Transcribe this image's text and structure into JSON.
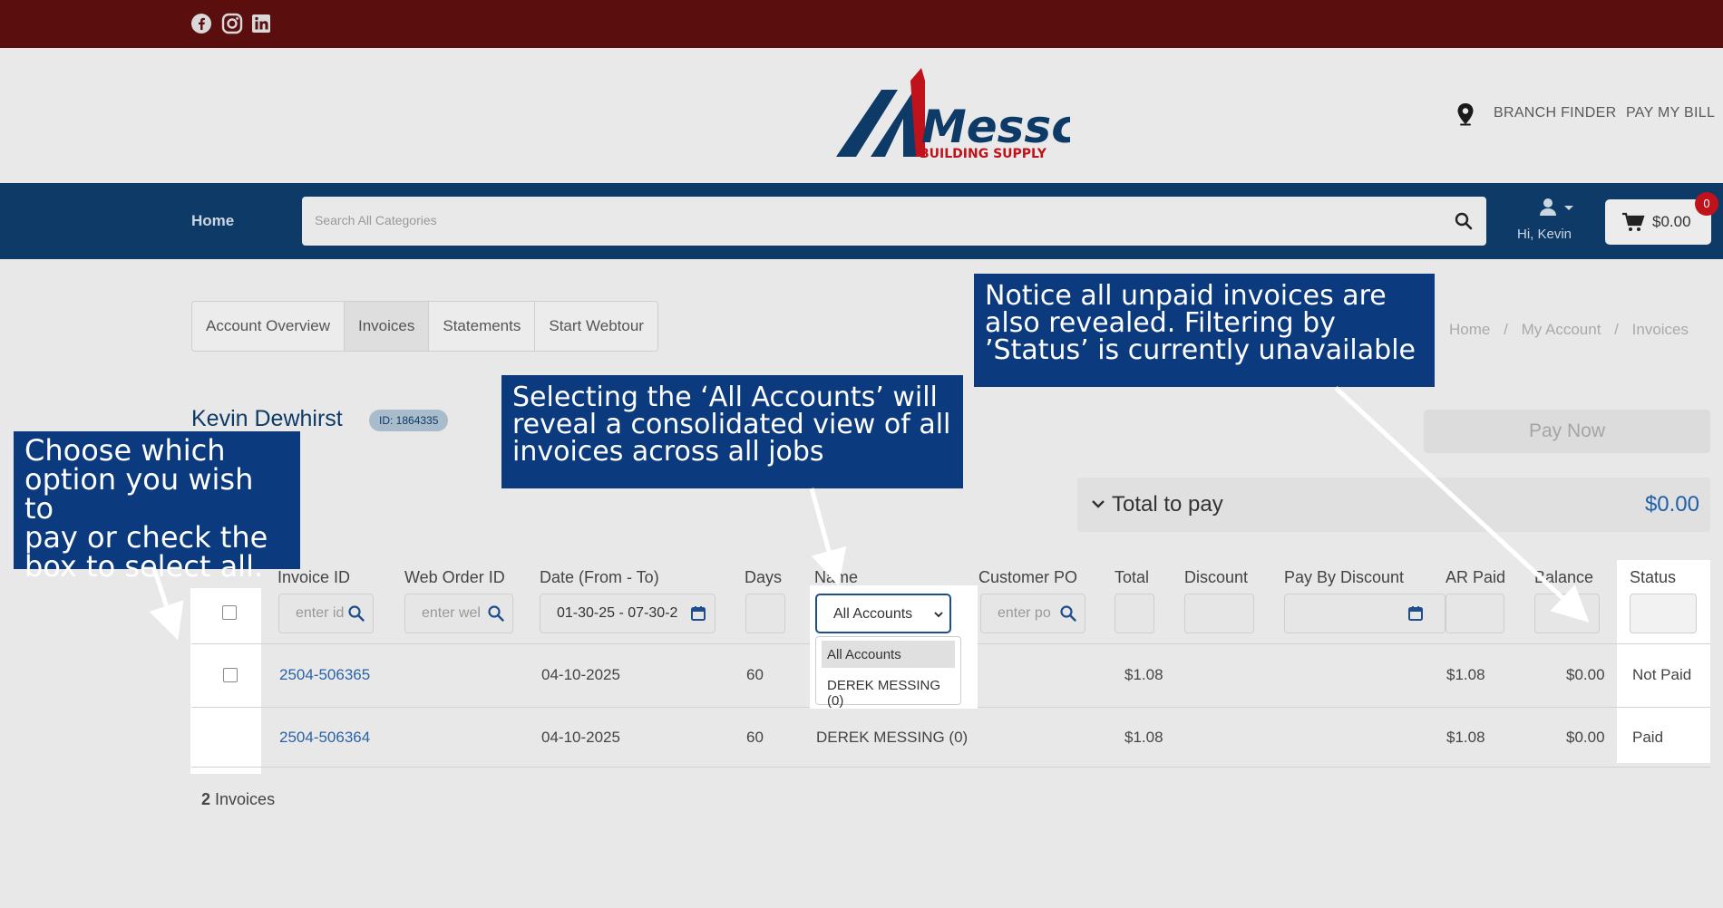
{
  "colors": {
    "top_bar": "#5a0e0e",
    "nav": "#0d3a66",
    "callout": "#0b3a7e",
    "link": "#2a63a6",
    "logo_red": "#c0121a",
    "logo_blue": "#0d3a66"
  },
  "social": [
    "facebook-icon",
    "instagram-icon",
    "linkedin-icon"
  ],
  "logo": {
    "name": "Messco",
    "tagline": "BUILDING SUPPLY"
  },
  "header": {
    "branch_finder": "BRANCH FINDER",
    "pay_bill": "PAY MY BILL"
  },
  "nav": {
    "home": "Home",
    "search_placeholder": "Search All Categories",
    "user_greeting": "Hi, Kevin",
    "cart_total": "$0.00",
    "cart_count": "0"
  },
  "tabs": [
    "Account Overview",
    "Invoices",
    "Statements",
    "Start Webtour"
  ],
  "breadcrumb": [
    "Home",
    "/",
    "My Account",
    "/",
    "Invoices"
  ],
  "customer": {
    "name": "Kevin Dewhirst",
    "id_label": "ID: 1864335"
  },
  "pay_now": "Pay Now",
  "total": {
    "label": "Total to pay",
    "amount": "$0.00"
  },
  "columns": {
    "invoice_id": "Invoice ID",
    "web_order_id": "Web Order ID",
    "date": "Date (From - To)",
    "days": "Days",
    "name": "Name",
    "customer_po": "Customer PO",
    "total": "Total",
    "discount": "Discount",
    "pay_by_discount": "Pay By Discount",
    "ar_paid": "AR Paid",
    "balance": "Balance",
    "status": "Status"
  },
  "filters": {
    "invoice_id_placeholder": "enter id",
    "web_order_placeholder": "enter wel",
    "date_range": "01-30-25 - 07-30-2",
    "po_placeholder": "enter po",
    "account_select": "All Accounts"
  },
  "account_options": [
    "All Accounts",
    "DEREK MESSING (0)"
  ],
  "rows": [
    {
      "invoice_id": "2504-506365",
      "date": "04-10-2025",
      "days": "60",
      "name": "",
      "total": "$1.08",
      "ar_paid": "$1.08",
      "balance": "$0.00",
      "status": "Not Paid"
    },
    {
      "invoice_id": "2504-506364",
      "date": "04-10-2025",
      "days": "60",
      "name": "DEREK MESSING (0)",
      "total": "$1.08",
      "ar_paid": "$1.08",
      "balance": "$0.00",
      "status": "Paid"
    }
  ],
  "footer": {
    "count": "2",
    "label": "Invoices"
  },
  "callouts": {
    "checkbox": [
      "Choose which",
      "option you wish to",
      "pay or check the",
      "box to select all."
    ],
    "accounts": [
      "Selecting the ‘All Accounts’ will",
      "reveal a consolidated view of all",
      "invoices across all jobs"
    ],
    "status": [
      "Notice all unpaid invoices are",
      "also revealed. Filtering by",
      "’Status’ is currently unavailable"
    ]
  }
}
